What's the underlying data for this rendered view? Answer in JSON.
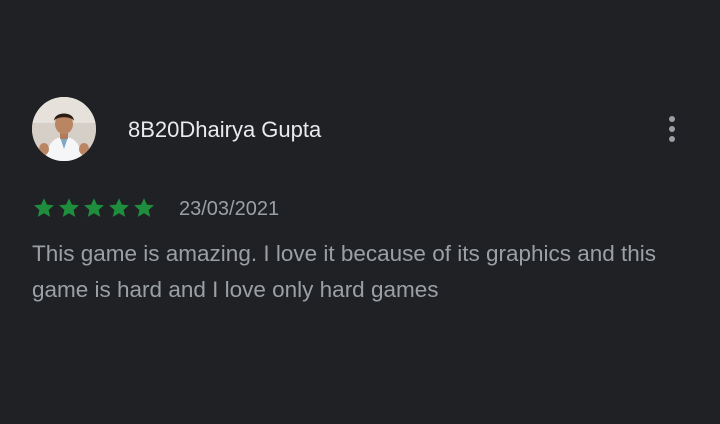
{
  "review": {
    "author": "8B20Dhairya Gupta",
    "avatar_icon": "user-avatar-photo",
    "more_icon": "more-vert-icon",
    "rating": 5,
    "rating_max": 5,
    "star_icon": "star-icon",
    "star_color": "#1e8e3e",
    "date": "23/03/2021",
    "text": "This game is amazing. I love it because of its graphics and this game is hard and I love only hard games"
  },
  "colors": {
    "background": "#202124",
    "name_text": "#e8eaed",
    "secondary_text": "#9aa0a6"
  }
}
